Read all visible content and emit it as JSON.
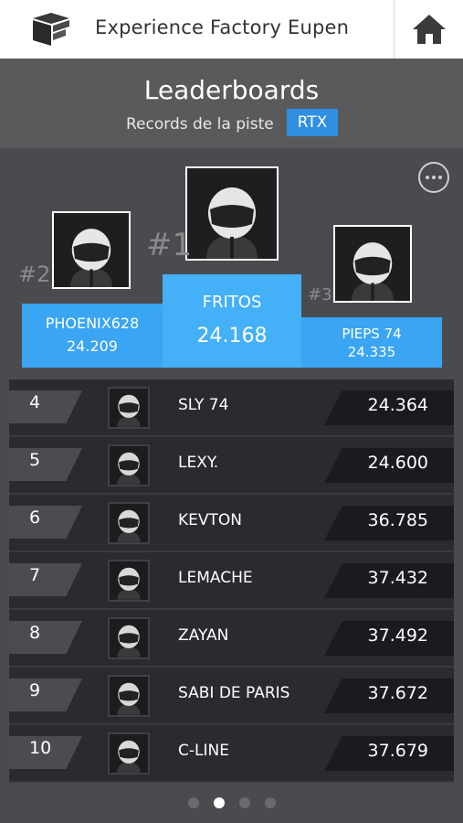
{
  "app": {
    "title": "Experience Factory Eupen"
  },
  "header": {
    "title": "Leaderboards",
    "subtitle": "Records de la piste",
    "badge": "RTX"
  },
  "podium": [
    {
      "rank": "#1",
      "name": "FRITOS",
      "time": "24.168"
    },
    {
      "rank": "#2",
      "name": "PHOENIX628",
      "time": "24.209"
    },
    {
      "rank": "#3",
      "name": "PIEPS 74",
      "time": "24.335"
    }
  ],
  "leaderboard": [
    {
      "rank": "4",
      "name": "SLY 74",
      "time": "24.364"
    },
    {
      "rank": "5",
      "name": "LEXY.",
      "time": "24.600"
    },
    {
      "rank": "6",
      "name": "KEVTON",
      "time": "36.785"
    },
    {
      "rank": "7",
      "name": "LEMACHE",
      "time": "37.432"
    },
    {
      "rank": "8",
      "name": "ZAYAN",
      "time": "37.492"
    },
    {
      "rank": "9",
      "name": "SABI DE PARIS",
      "time": "37.672"
    },
    {
      "rank": "10",
      "name": "C-LINE",
      "time": "37.679"
    }
  ],
  "pager": {
    "pages": 4,
    "active": 1
  },
  "colors": {
    "accent": "#2f8fe0",
    "podium": "#3aa5f2",
    "background": "#4a4b4e"
  }
}
